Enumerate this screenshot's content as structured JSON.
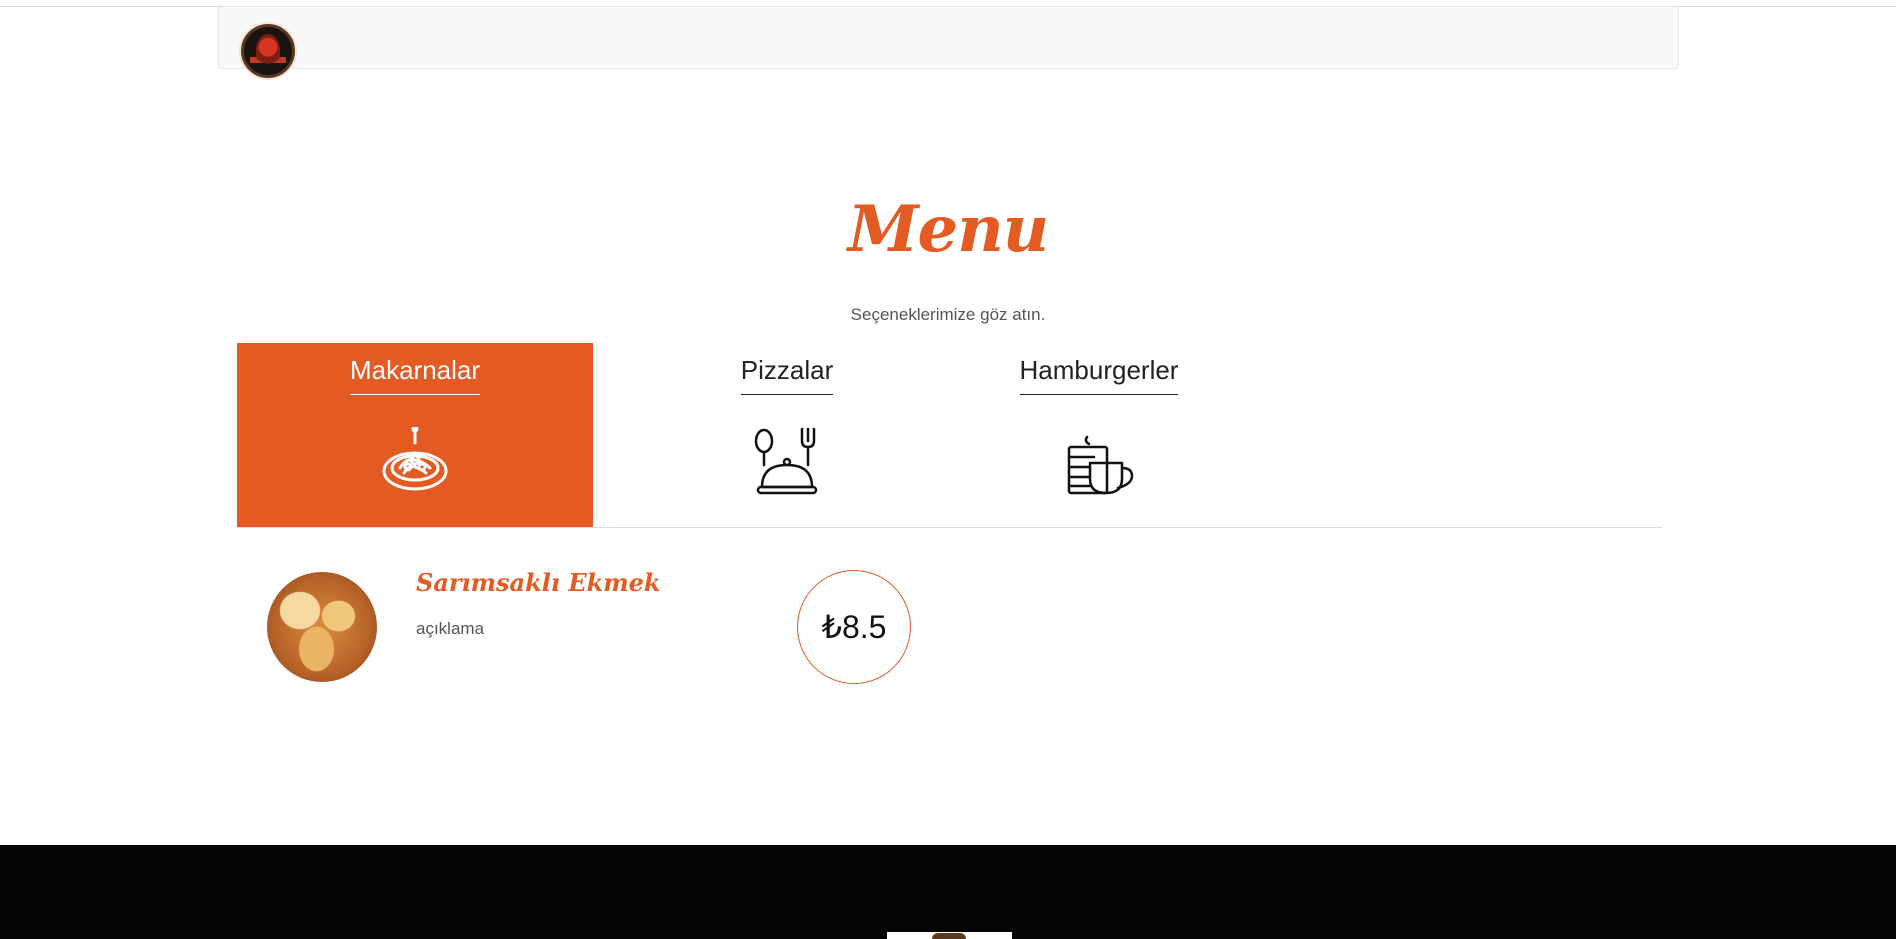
{
  "header": {
    "logo_icon": "restaurant-logo"
  },
  "menu_section": {
    "title": "Menu",
    "subtitle": "Seçeneklerimize göz atın."
  },
  "tabs": [
    {
      "label": "Makarnalar",
      "icon": "pasta-plate-icon",
      "active": true
    },
    {
      "label": "Pizzalar",
      "icon": "cloche-cutlery-icon",
      "active": false
    },
    {
      "label": "Hamburgerler",
      "icon": "coffee-cake-icon",
      "active": false
    }
  ],
  "items": [
    {
      "name": "Sarımsaklı Ekmek",
      "description": "açıklama",
      "price": "₺8.5",
      "image": "garlic-bread-photo"
    }
  ],
  "colors": {
    "accent": "#e35a22",
    "footer": "#050505",
    "navbar": "#f8f8f8"
  }
}
